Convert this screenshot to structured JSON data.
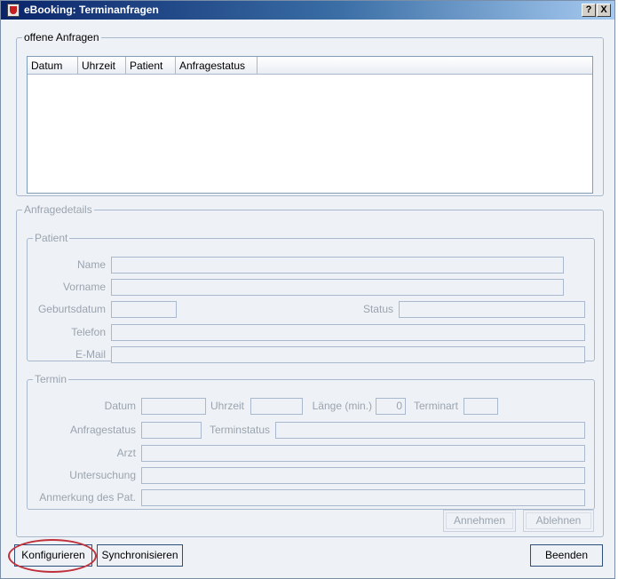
{
  "window": {
    "title": "eBooking: Terminanfragen",
    "help_button": "?",
    "close_button": "X",
    "app_icon": "shield-app-icon"
  },
  "requests": {
    "legend": "offene Anfragen",
    "columns": [
      "Datum",
      "Uhrzeit",
      "Patient",
      "Anfragestatus"
    ],
    "rows": []
  },
  "details": {
    "legend": "Anfragedetails",
    "patient": {
      "legend": "Patient",
      "name_label": "Name",
      "name_value": "",
      "vorname_label": "Vorname",
      "vorname_value": "",
      "geburtsdatum_label": "Geburtsdatum",
      "geburtsdatum_value": "",
      "status_label": "Status",
      "status_value": "",
      "telefon_label": "Telefon",
      "telefon_value": "",
      "email_label": "E-Mail",
      "email_value": ""
    },
    "termin": {
      "legend": "Termin",
      "datum_label": "Datum",
      "datum_value": "",
      "uhrzeit_label": "Uhrzeit",
      "uhrzeit_value": "",
      "laenge_label": "Länge (min.)",
      "laenge_value": "0",
      "terminart_label": "Terminart",
      "terminart_value": "",
      "anfragestatus_label": "Anfragestatus",
      "anfragestatus_value": "",
      "terminstatus_label": "Terminstatus",
      "terminstatus_value": "",
      "arzt_label": "Arzt",
      "arzt_value": "",
      "untersuchung_label": "Untersuchung",
      "untersuchung_value": "",
      "anmerkung_label": "Anmerkung des Pat.",
      "anmerkung_value": ""
    },
    "annehmen_button": "Annehmen",
    "ablehnen_button": "Ablehnen"
  },
  "footer": {
    "konfigurieren_button": "Konfigurieren",
    "synchronisieren_button": "Synchronisieren",
    "beenden_button": "Beenden"
  },
  "colors": {
    "titlebar_start": "#0a246a",
    "titlebar_end": "#a6caf0",
    "dialog_background": "#eef2f6",
    "disabled_text": "#9aa3ae",
    "highlight_ring": "#c0303a"
  }
}
